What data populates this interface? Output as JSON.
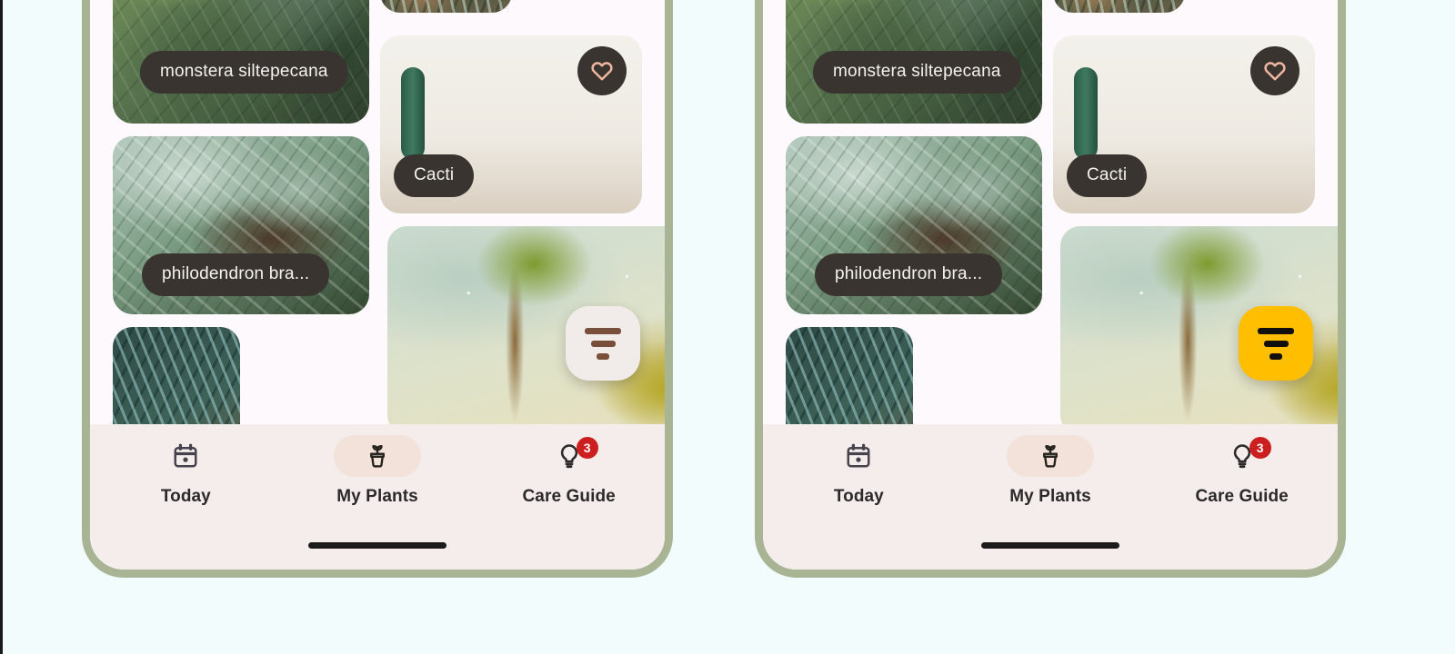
{
  "page": {
    "background_color": "#F2FCFC",
    "frame_border_color": "#A9B494",
    "screen_background": "#FDF9FC"
  },
  "colors": {
    "chip_bg": "#3A3430",
    "chip_text": "#F4F2EF",
    "heart_outline": "#F0B7A0",
    "fab_light_bg": "#F1ECEA",
    "fab_light_icon": "#7A4F3A",
    "fab_amber_bg": "#FFBF00",
    "fab_amber_icon": "#12100E",
    "navbar_bg": "#F5EDEC",
    "nav_active_pill": "#F3E2DA",
    "nav_label": "#2C2A29",
    "badge_bg": "#CC1F1F"
  },
  "phones": [
    {
      "id": "phone-left",
      "fab": {
        "name": "filter-fab",
        "variant": "light",
        "icon": "filter-icon"
      }
    },
    {
      "id": "phone-right",
      "fab": {
        "name": "filter-fab",
        "variant": "amber",
        "icon": "filter-icon"
      }
    }
  ],
  "plant_grid": {
    "cards": [
      {
        "id": "monstera",
        "label": "monstera siltepecana",
        "has_label": true,
        "has_favorite": false,
        "photo": "monstera"
      },
      {
        "id": "palm",
        "label": "",
        "has_label": false,
        "has_favorite": false,
        "photo": "palm"
      },
      {
        "id": "philodendron",
        "label": "philodendron bra...",
        "has_label": true,
        "has_favorite": false,
        "photo": "philo"
      },
      {
        "id": "cacti",
        "label": "Cacti",
        "has_label": true,
        "has_favorite": true,
        "photo": "cacti"
      },
      {
        "id": "dracaena",
        "label": "",
        "has_label": false,
        "has_favorite": false,
        "photo": "dracaena"
      },
      {
        "id": "fern",
        "label": "",
        "has_label": false,
        "has_favorite": false,
        "photo": "fern"
      }
    ]
  },
  "bottom_nav": {
    "items": [
      {
        "id": "today",
        "label": "Today",
        "icon": "calendar-icon",
        "active": false,
        "badge": null
      },
      {
        "id": "my-plants",
        "label": "My Plants",
        "icon": "plant-pot-icon",
        "active": true,
        "badge": null
      },
      {
        "id": "care-guide",
        "label": "Care Guide",
        "icon": "lightbulb-icon",
        "active": false,
        "badge": "3"
      }
    ]
  }
}
